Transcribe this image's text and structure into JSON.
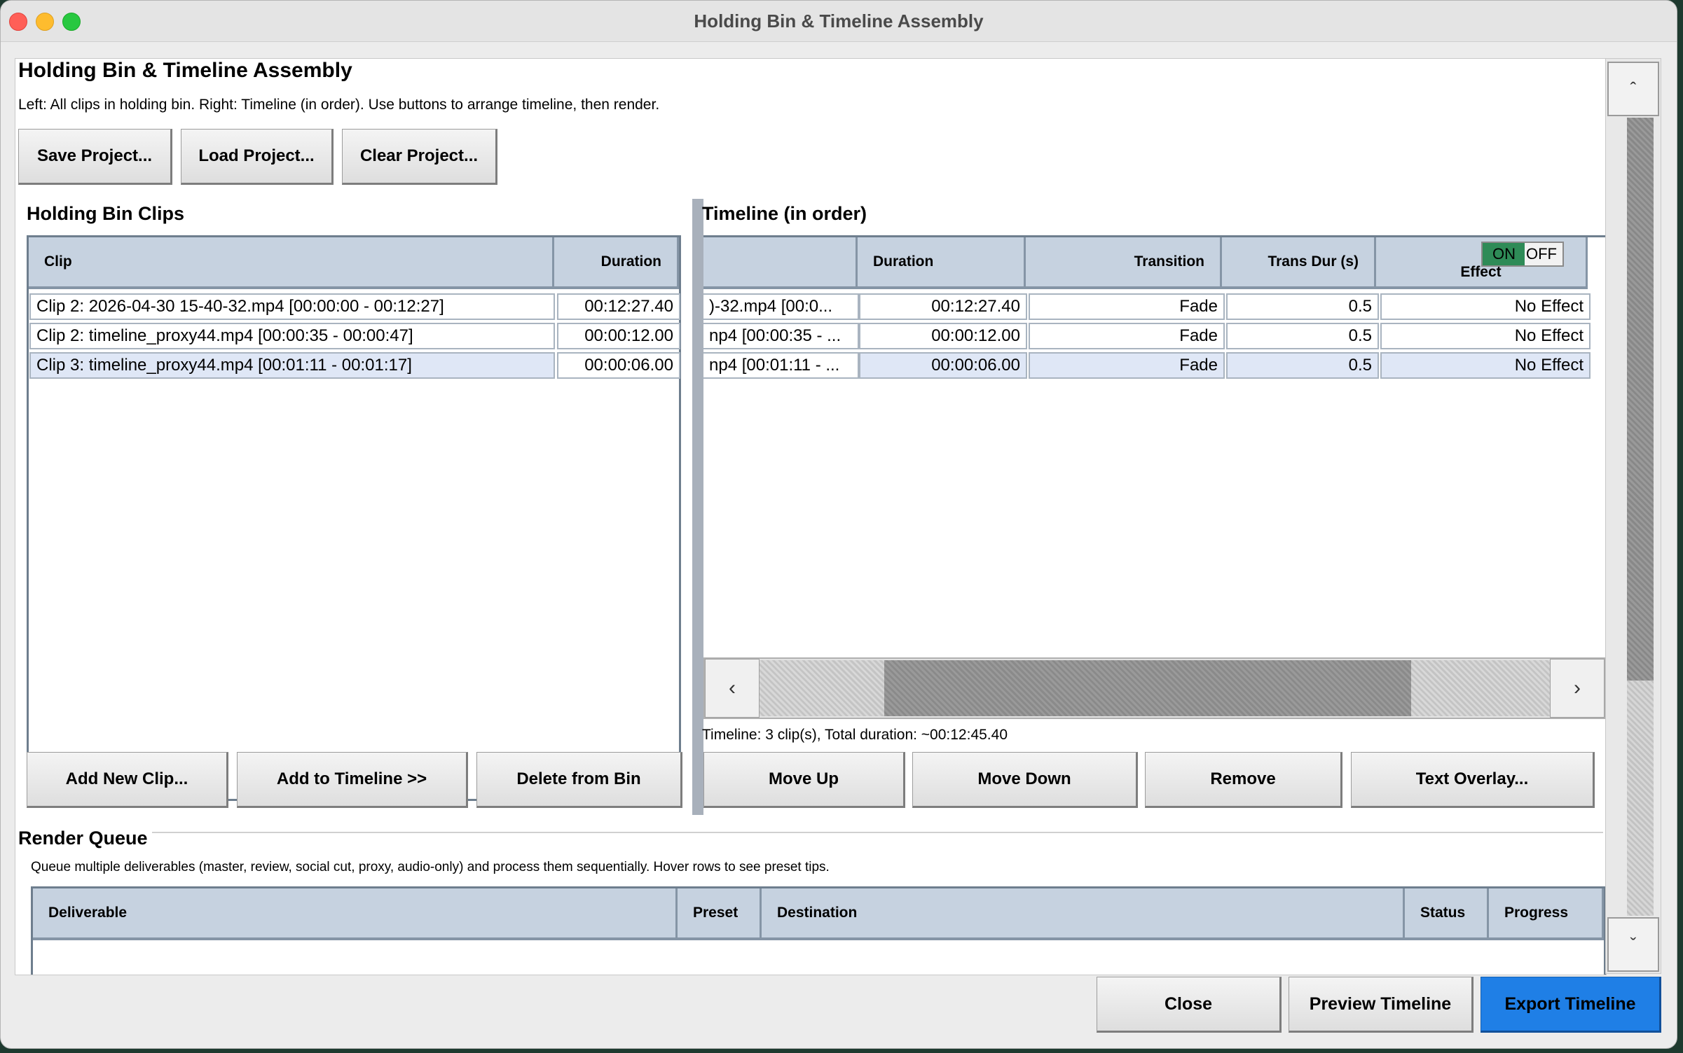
{
  "window": {
    "title": "Holding Bin & Timeline Assembly"
  },
  "header": {
    "title": "Holding Bin & Timeline Assembly",
    "description": "Left: All clips in holding bin. Right: Timeline (in order). Use buttons to arrange timeline, then render."
  },
  "project_buttons": {
    "save": "Save Project...",
    "load": "Load Project...",
    "clear": "Clear Project..."
  },
  "bin": {
    "title": "Holding Bin Clips",
    "columns": {
      "clip": "Clip",
      "duration": "Duration"
    },
    "rows": [
      {
        "clip": "Clip 2: 2026-04-30 15-40-32.mp4 [00:00:00 - 00:12:27]",
        "duration": "00:12:27.40"
      },
      {
        "clip": "Clip 2: timeline_proxy44.mp4 [00:00:35 - 00:00:47]",
        "duration": "00:00:12.00"
      },
      {
        "clip": "Clip 3: timeline_proxy44.mp4 [00:01:11 - 00:01:17]",
        "duration": "00:00:06.00"
      }
    ],
    "buttons": {
      "add_new": "Add New Clip...",
      "add_to_timeline": "Add to Timeline >>",
      "delete": "Delete from Bin"
    }
  },
  "timeline": {
    "title": "Timeline (in order)",
    "columns": {
      "clip": "",
      "duration": "Duration",
      "transition": "Transition",
      "trans_dur": "Trans Dur (s)",
      "effect": "Effect",
      "toggle_on": "ON",
      "toggle_off": "OFF"
    },
    "rows": [
      {
        "clip": ")-32.mp4 [00:0...",
        "duration": "00:12:27.40",
        "transition": "Fade",
        "trans_dur": "0.5",
        "effect": "No Effect"
      },
      {
        "clip": "np4 [00:00:35 - ...",
        "duration": "00:00:12.00",
        "transition": "Fade",
        "trans_dur": "0.5",
        "effect": "No Effect"
      },
      {
        "clip": "np4 [00:01:11 - ...",
        "duration": "00:00:06.00",
        "transition": "Fade",
        "trans_dur": "0.5",
        "effect": "No Effect"
      }
    ],
    "summary": "Timeline: 3 clip(s), Total duration: ~00:12:45.40",
    "buttons": {
      "move_up": "Move Up",
      "move_down": "Move Down",
      "remove": "Remove",
      "text_overlay": "Text Overlay..."
    }
  },
  "render_queue": {
    "title": "Render Queue",
    "description": "Queue multiple deliverables (master, review, social cut, proxy, audio-only) and process them sequentially. Hover rows to see preset tips.",
    "columns": {
      "deliverable": "Deliverable",
      "preset": "Preset",
      "destination": "Destination",
      "status": "Status",
      "progress": "Progress"
    }
  },
  "footer": {
    "close": "Close",
    "preview": "Preview Timeline",
    "export": "Export Timeline"
  },
  "colors": {
    "accent": "#1f7fe6",
    "header_bg": "#c6d2e0",
    "selected_row": "#dfe7f6",
    "toggle_on": "#2e8b57"
  }
}
